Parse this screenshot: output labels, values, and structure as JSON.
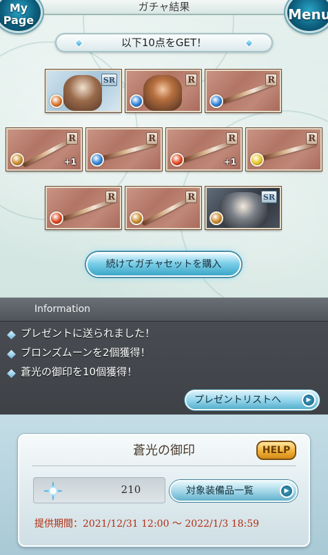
{
  "header": {
    "title": "ガチャ結果",
    "mypage_label": "My\nPage",
    "menu_label": "Menu"
  },
  "banner": {
    "text": "以下10点をGET！"
  },
  "results": [
    {
      "rarity": "SR",
      "element": "fire-orange",
      "plus": ""
    },
    {
      "rarity": "R",
      "element": "water",
      "plus": ""
    },
    {
      "rarity": "R",
      "element": "water",
      "plus": ""
    },
    {
      "rarity": "R",
      "element": "earth",
      "plus": "+1"
    },
    {
      "rarity": "R",
      "element": "water",
      "plus": ""
    },
    {
      "rarity": "R",
      "element": "fire",
      "plus": "+1"
    },
    {
      "rarity": "R",
      "element": "light",
      "plus": ""
    },
    {
      "rarity": "R",
      "element": "fire",
      "plus": ""
    },
    {
      "rarity": "R",
      "element": "earth",
      "plus": ""
    },
    {
      "rarity": "SR",
      "element": "earth",
      "plus": ""
    }
  ],
  "continue_button": "続けてガチャセットを購入",
  "information": {
    "title": "Information",
    "lines": [
      "プレゼントに送られました！",
      "ブロンズムーンを2個獲得！",
      "蒼光の御印を10個獲得！"
    ],
    "present_button": "プレゼントリストへ"
  },
  "seal": {
    "title": "蒼光の御印",
    "help": "HELP",
    "count": "210",
    "equip_button": "対象装備品一覧",
    "period": "提供期間：2021/12/31 12:00 〜 2022/1/3 18:59"
  },
  "colors": {
    "fire": "#e0431f",
    "water": "#2a7fd6",
    "earth": "#c98a2a",
    "light": "#e8c41f",
    "fire-orange": "#d9732a"
  }
}
